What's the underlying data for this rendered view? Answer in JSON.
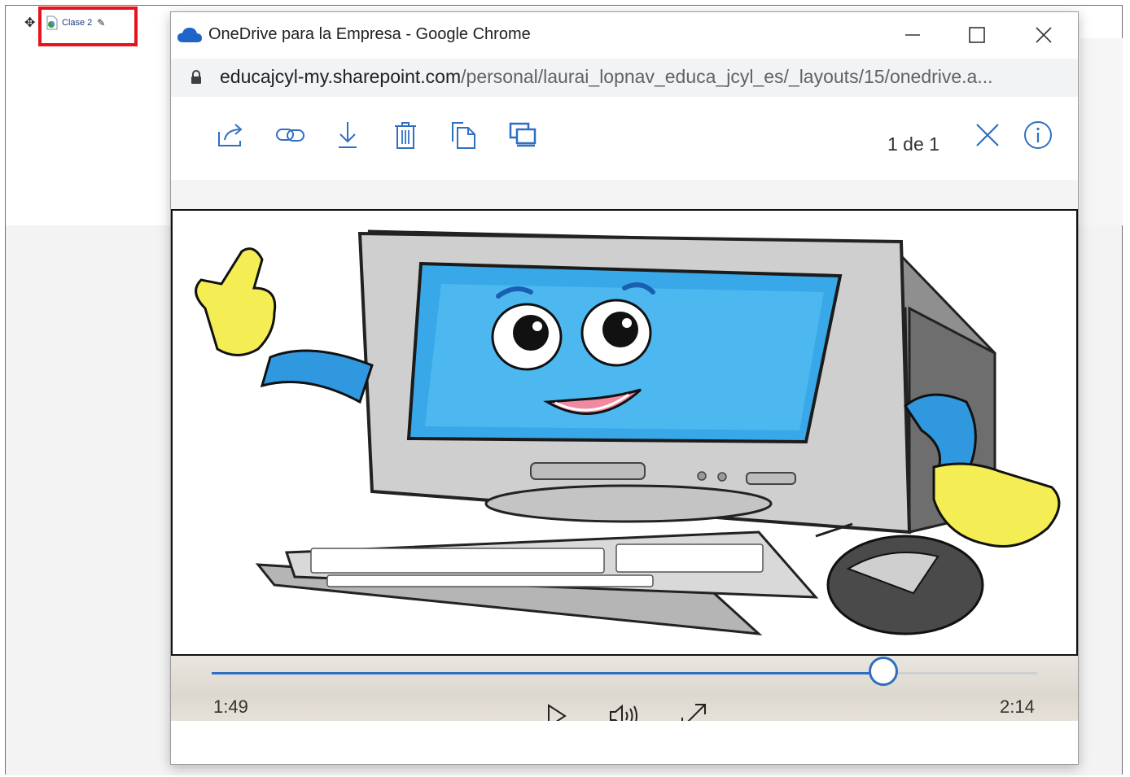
{
  "page": {
    "move_icon": "move-icon",
    "file_link_label": "Clase 2",
    "highlight_color": "#e8141c"
  },
  "popup": {
    "title": "OneDrive para la Empresa - Google Chrome",
    "url_host": "educajcyl-my.sharepoint.com",
    "url_path": "/personal/laurai_lopnav_educa_jcyl_es/_layouts/15/onedrive.a...",
    "window_buttons": [
      "minimize-icon",
      "maximize-icon",
      "close-icon"
    ]
  },
  "toolbar": {
    "icons": [
      "share-icon",
      "link-icon",
      "download-icon",
      "delete-icon",
      "copy-icon",
      "move-to-icon"
    ],
    "page_count": "1 de 1",
    "accent": "#2f6fc2"
  },
  "player": {
    "current_time": "1:49",
    "duration": "2:14",
    "progress": 0.8134,
    "buttons": [
      "play-icon",
      "volume-icon",
      "fullscreen-icon"
    ]
  }
}
